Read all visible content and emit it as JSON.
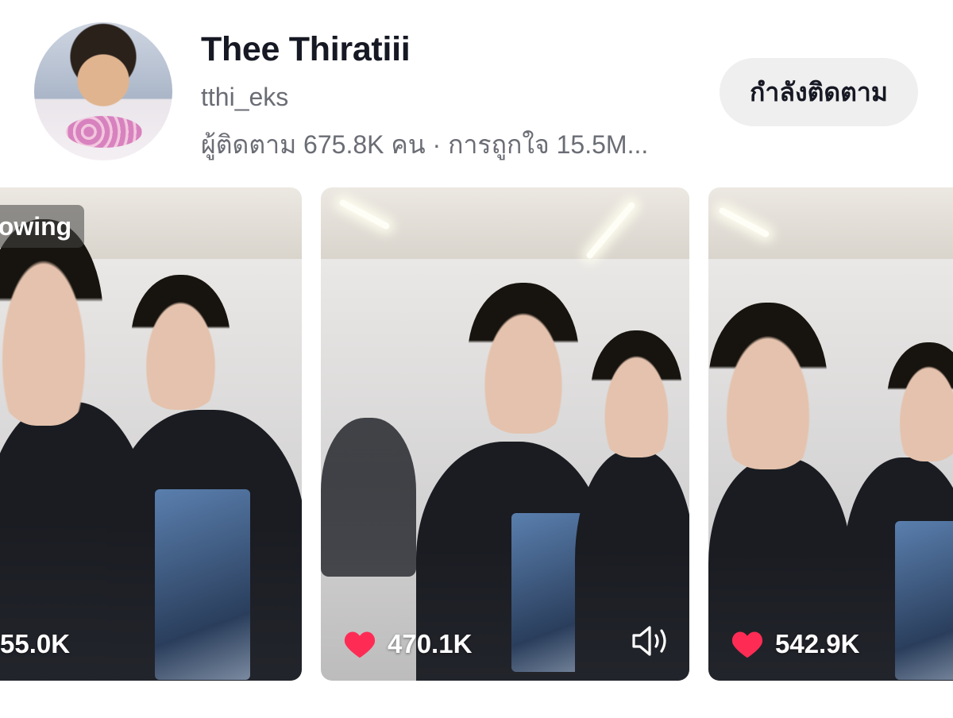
{
  "profile": {
    "name": "Thee Thiratiii",
    "handle": "tthi_eks",
    "stats": "ผู้ติดตาม 675.8K คน · การถูกใจ 15.5M..."
  },
  "follow_button": {
    "label": "กำลังติดตาม"
  },
  "videos": [
    {
      "badge": "llowing",
      "likes": "55.0K"
    },
    {
      "likes": "470.1K",
      "icon": "sound-icon"
    },
    {
      "likes": "542.9K"
    }
  ],
  "colors": {
    "heart": "#fe2c55",
    "button_bg": "#efefef",
    "secondary_text": "#6b6d75"
  }
}
